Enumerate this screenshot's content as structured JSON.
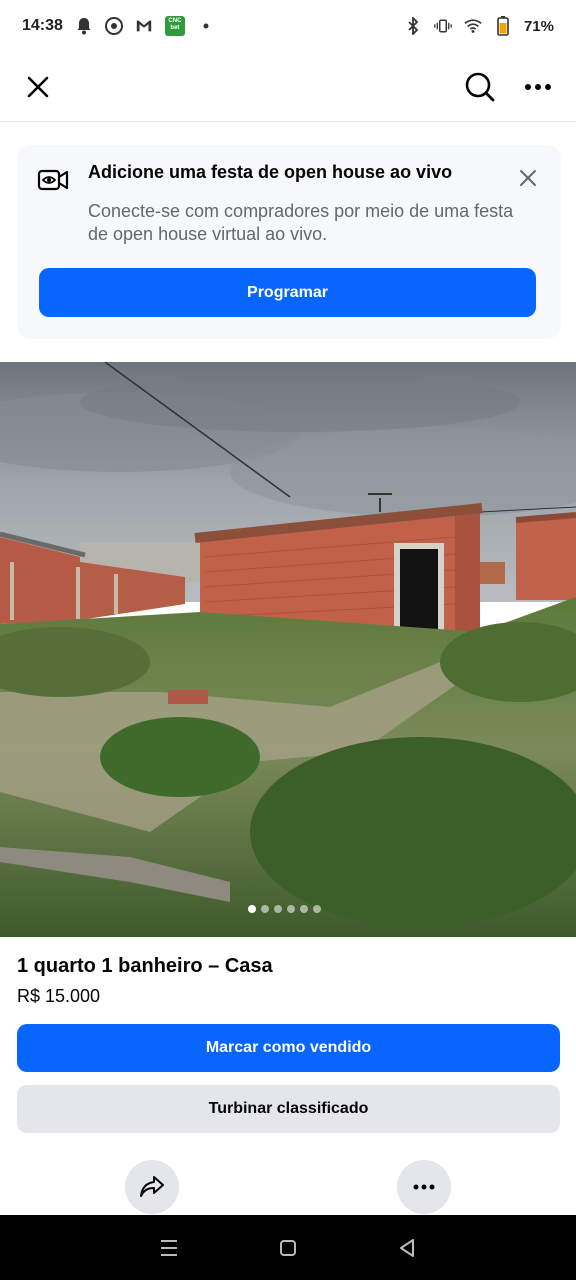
{
  "status_bar": {
    "time": "14:38",
    "cnc_badge_text": "CNC bet",
    "battery_percent": "71%",
    "icons": [
      "notification-bell-icon",
      "chrome-icon",
      "gmail-icon",
      "cnc-bet-icon",
      "dot-icon",
      "bluetooth-icon",
      "vibrate-icon",
      "wifi-icon",
      "battery-icon"
    ]
  },
  "top_nav": {
    "icons": [
      "close-icon",
      "search-icon",
      "more-horizontal-icon"
    ]
  },
  "banner": {
    "title": "Adicione uma festa de open house ao vivo",
    "description": "Conecte-se com compradores por meio de uma festa de open house virtual ao vivo.",
    "button_label": "Programar",
    "icons": [
      "live-video-icon",
      "close-icon"
    ]
  },
  "photo": {
    "page_count": 6,
    "active_page": 1
  },
  "listing": {
    "title": "1 quarto 1 banheiro – Casa",
    "price": "R$ 15.000",
    "mark_sold_label": "Marcar como vendido",
    "boost_label": "Turbinar classificado",
    "actions": [
      "share-icon",
      "more-horizontal-icon"
    ]
  },
  "system_nav": {
    "icons": [
      "recents-icon",
      "home-icon",
      "back-icon"
    ]
  },
  "colors": {
    "primary": "#0866ff",
    "secondary_button": "#e4e6eb",
    "banner_bg": "#f7f8fa",
    "text": "#050505",
    "muted_text": "#65676b"
  }
}
